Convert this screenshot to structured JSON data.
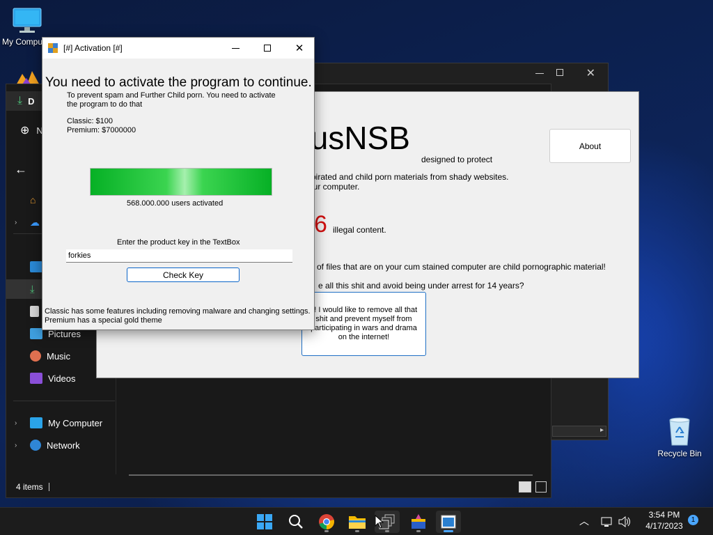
{
  "desktop": {
    "icons": [
      {
        "label": "My Computer"
      },
      {
        "label": "Recycle Bin"
      }
    ]
  },
  "explorer": {
    "nav": {
      "downloads_short": "D",
      "new_short": "N",
      "pictures": "Pictures",
      "music": "Music",
      "videos": "Videos",
      "my_computer": "My Computer",
      "network": "Network"
    },
    "status": "4 items"
  },
  "antivirus": {
    "title": "ivirusNSB",
    "subtitle": "designed to protect",
    "about_label": "About",
    "line1": "g pirated and child porn materials from shady websites.",
    "line2": "our computer.",
    "count_digit": "6",
    "count_label": "illegal content.",
    "line3": "of files that are on your cum stained computer are child pornographic material!",
    "line4": "e all this shit and avoid being under arrest for 14 years?",
    "remove_button": "s! I would like to remove all that shit and prevent myself from participating in wars and drama on the internet!"
  },
  "activation": {
    "window_title": "[#] Activation [#]",
    "heading": "You need to activate the program to continue.",
    "desc_line1": "To prevent spam and Further Child porn. You need to activate",
    "desc_line2": "the program to do that",
    "classic_price": "Classic: $100",
    "premium_price": "Premium: $7000000",
    "progress_fraction": 1.0,
    "users_activated": "568.000.000 users activated",
    "key_prompt": "Enter the product key in the TextBox",
    "key_value": "forkies",
    "check_button": "Check Key",
    "footer_line1": "Classic has some features including removing malware and changing settings.",
    "footer_line2": "Premium has a special gold theme"
  },
  "taskbar": {
    "time": "3:54 PM",
    "date": "4/17/2023",
    "notification_count": "1"
  },
  "colors": {
    "accent": "#0a64c8",
    "progress_green": "#06b025",
    "count_red": "#d01010"
  }
}
